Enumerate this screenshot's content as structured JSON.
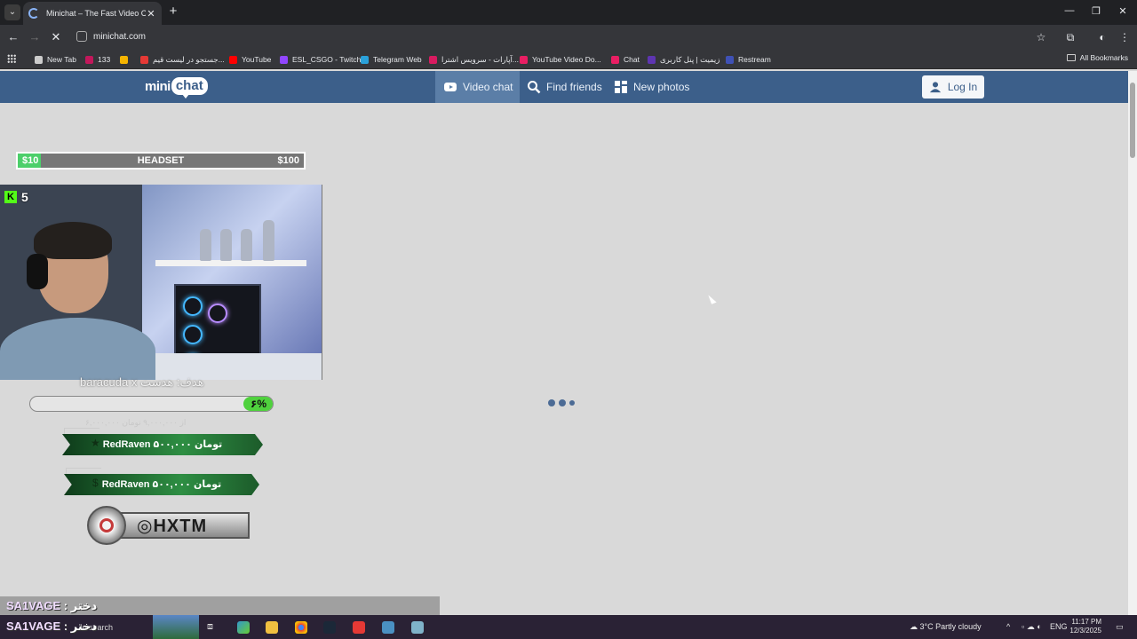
{
  "browser": {
    "tab_title": "Minichat – The Fast Video Chat",
    "url": "minichat.com",
    "bookmarks": [
      {
        "label": "New Tab",
        "color": "#cccccc"
      },
      {
        "label": "133",
        "color": "#c2185b"
      },
      {
        "label": "",
        "color": "#f5b400"
      },
      {
        "label": "جستجو در لیست قیم...",
        "color": "#e53935"
      },
      {
        "label": "YouTube",
        "color": "#ff0000"
      },
      {
        "label": "ESL_CSGO - Twitch",
        "color": "#9146ff"
      },
      {
        "label": "Telegram Web",
        "color": "#2aa1da"
      },
      {
        "label": "آپارات - سرویس اشترا...",
        "color": "#d81b60"
      },
      {
        "label": "YouTube Video Do...",
        "color": "#e91e63"
      },
      {
        "label": "Chat",
        "color": "#e91e63"
      },
      {
        "label": "زیمیت | پنل کاربری",
        "color": "#5e35b1"
      },
      {
        "label": "Restream",
        "color": "#3f51b5"
      }
    ],
    "all_bookmarks": "All Bookmarks"
  },
  "site": {
    "logo_mini": "mini",
    "logo_chat": "chat",
    "nav": [
      {
        "label": "Video chat",
        "active": true
      },
      {
        "label": "Find friends",
        "active": false
      },
      {
        "label": "New photos",
        "active": false
      }
    ],
    "login": "Log In",
    "accent": "#3c5f8a"
  },
  "overlay": {
    "goal": {
      "left": "$10",
      "mid": "HEADSET",
      "right": "$100",
      "progress": 0.08
    },
    "kick_viewers": "5",
    "donor_label": "baracuda x هدف: هدست",
    "donation_percent_label": "۶%",
    "donation_progress": 0.12,
    "donation_sub": "۶,۰۰۰,۰۰۰ از ۹,۰۰۰,۰۰۰ تومان",
    "donations": [
      {
        "text": "RedRaven   ۵۰۰,۰۰۰ تومان"
      },
      {
        "text": "RedRaven   ۵۰۰,۰۰۰ تومان"
      }
    ],
    "social_handle": "HXTM"
  },
  "chat": [
    {
      "user": "SA1VAGE",
      "msg": " : دختر"
    },
    {
      "user": "SA1VAGE",
      "msg": " : دختر"
    }
  ],
  "taskbar": {
    "search_placeholder": "to search",
    "weather": "3°C  Partly cloudy",
    "lang": "ENG",
    "time": "11:17 PM",
    "date": "12/3/2025"
  }
}
